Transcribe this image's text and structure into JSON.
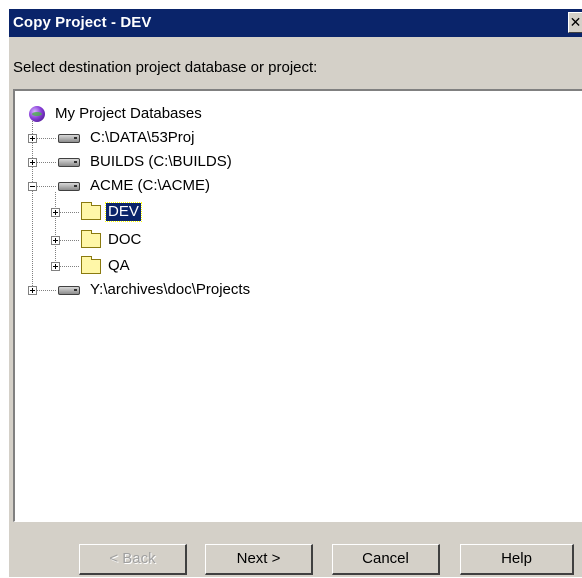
{
  "window": {
    "title": "Copy Project - DEV",
    "close_glyph": "✕"
  },
  "prompt": "Select destination project database or project:",
  "tree": {
    "root": {
      "label": "My Project Databases",
      "icon": "globe-icon"
    },
    "nodes": [
      {
        "label": "C:\\DATA\\53Proj",
        "icon": "drive-icon",
        "expander": "plus"
      },
      {
        "label": "BUILDS (C:\\BUILDS)",
        "icon": "drive-icon",
        "expander": "plus"
      },
      {
        "label": "ACME (C:\\ACME)",
        "icon": "drive-icon",
        "expander": "minus"
      },
      {
        "label": "DEV",
        "icon": "folder-icon",
        "expander": "plus",
        "selected": true
      },
      {
        "label": "DOC",
        "icon": "folder-icon",
        "expander": "plus"
      },
      {
        "label": "QA",
        "icon": "folder-icon",
        "expander": "plus"
      },
      {
        "label": "Y:\\archives\\doc\\Projects",
        "icon": "drive-icon",
        "expander": "plus"
      }
    ]
  },
  "buttons": {
    "back": "< Back",
    "next": "Next >",
    "cancel": "Cancel",
    "help": "Help"
  },
  "colors": {
    "titlebar": "#0a246a",
    "dialog": "#d4d0c8",
    "selection": "#0a246a",
    "folder": "#fff7a8"
  }
}
